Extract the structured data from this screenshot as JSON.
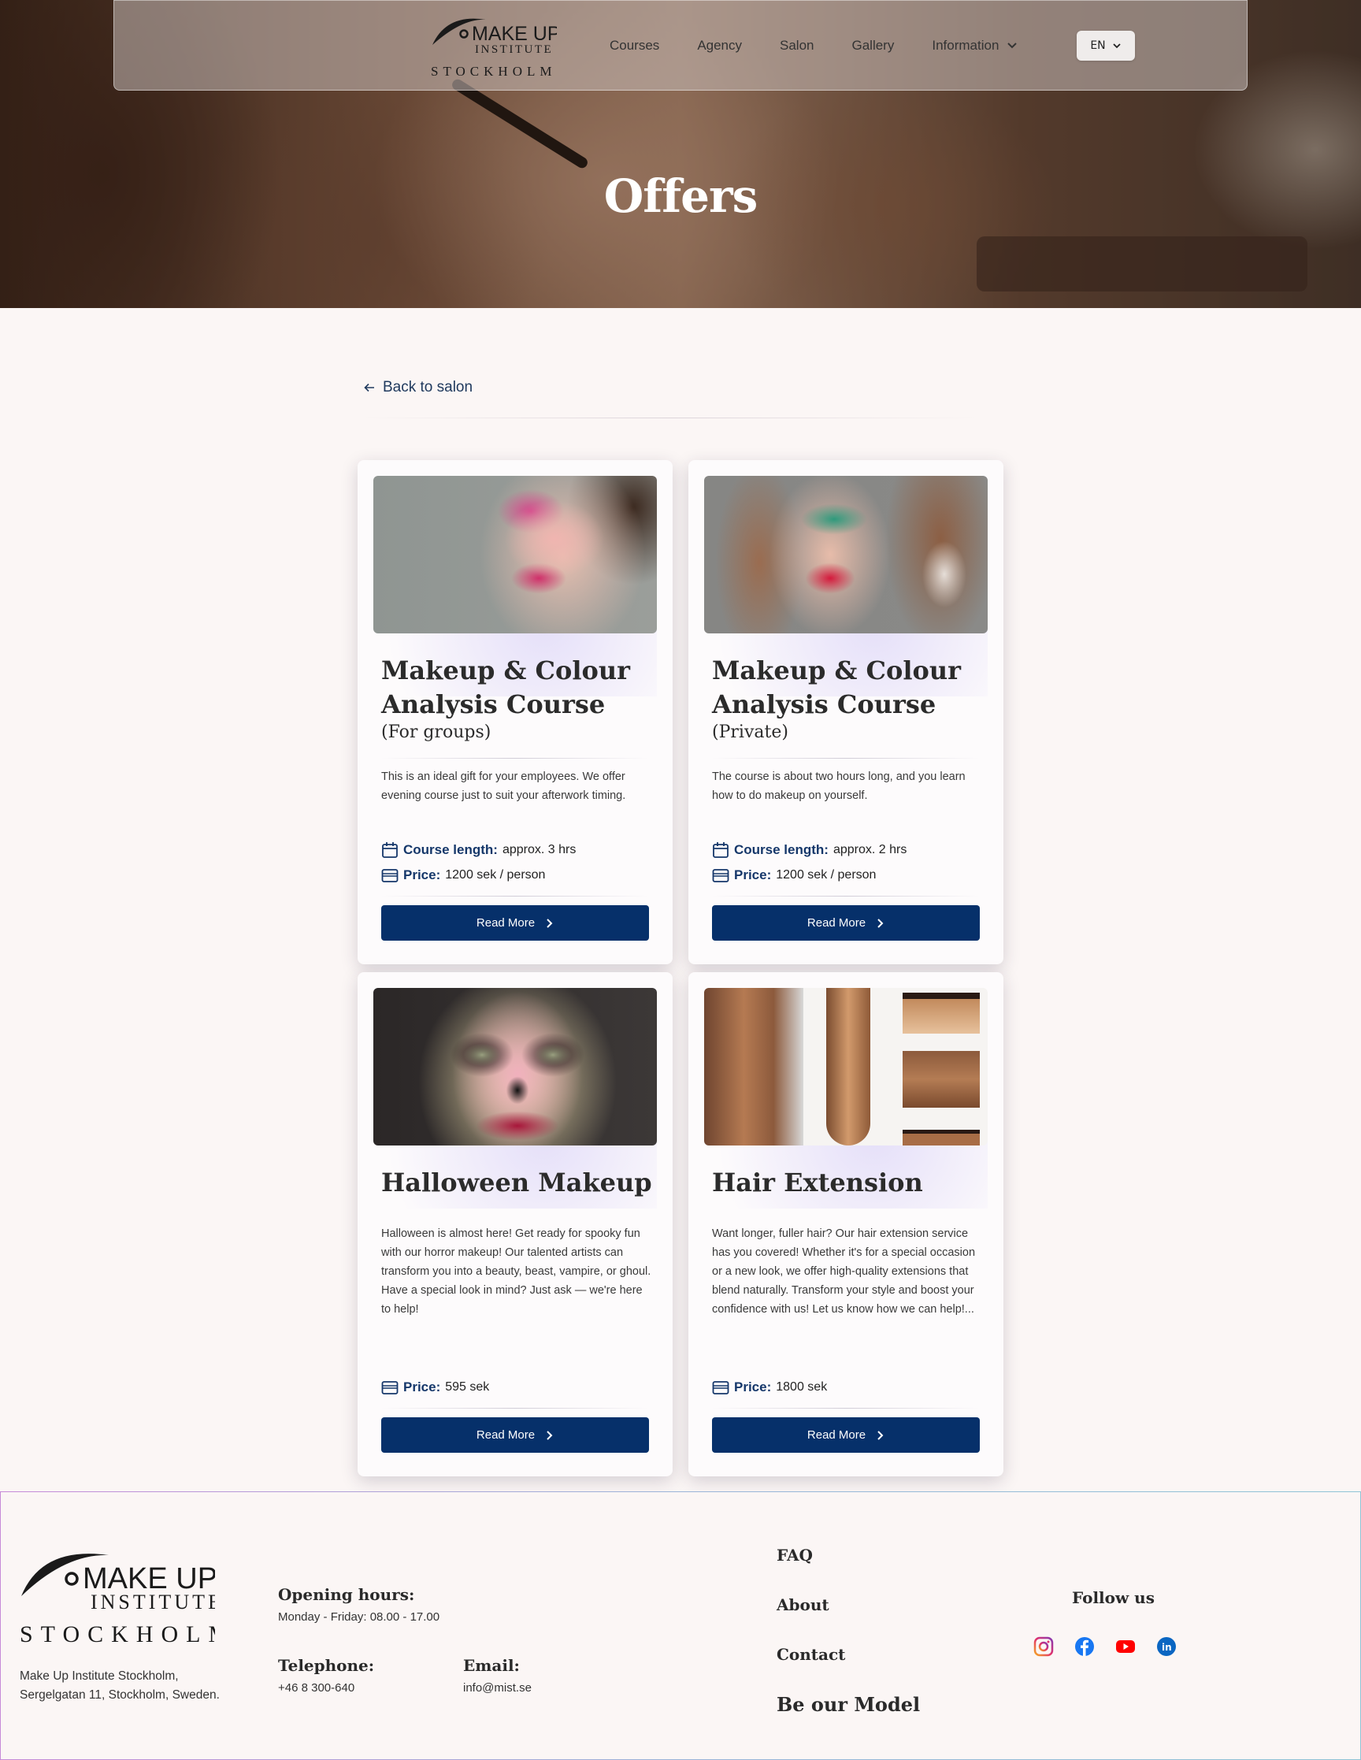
{
  "nav": {
    "logo": {
      "line1": "MAKE UP",
      "line2": "INSTITUTE",
      "line3": "STOCKHOLM"
    },
    "links": [
      "Courses",
      "Agency",
      "Salon",
      "Gallery",
      "Information"
    ],
    "lang": "EN"
  },
  "hero": {
    "title": "Offers"
  },
  "back_link": "Back to salon",
  "cards": [
    {
      "title": "Makeup & Colour Analysis Course",
      "subtitle": "(For groups)",
      "description": "This is an ideal gift for your employees. We offer evening course just to suit your afterwork timing.",
      "length_label": "Course length:",
      "length_value": "approx.  3 hrs",
      "price_label": "Price:",
      "price_value": "1200 sek / person",
      "button": "Read More"
    },
    {
      "title": "Makeup & Colour Analysis Course",
      "subtitle": "(Private)",
      "description": "The course is about two hours long, and you learn how to do makeup on yourself.",
      "length_label": "Course length:",
      "length_value": "approx.  2 hrs",
      "price_label": "Price:",
      "price_value": "1200 sek / person",
      "button": "Read More"
    },
    {
      "title": "Halloween Makeup",
      "description": "Halloween is almost here! Get ready for spooky fun with our horror makeup! Our talented artists can transform you into a beauty, beast, vampire, or ghoul. Have a special look in mind? Just ask — we're here to help!",
      "price_label": "Price:",
      "price_value": "595 sek",
      "button": "Read More"
    },
    {
      "title": "Hair Extension",
      "description": "Want longer, fuller hair? Our hair extension service has you covered! Whether it's for a special occasion or a new look, we offer high-quality extensions that blend naturally. Transform your style and boost your confidence with us! Let us know how we can help!...",
      "price_label": "Price:",
      "price_value": "1800 sek",
      "button": "Read More"
    }
  ],
  "footer": {
    "address_line1": "Make Up Institute Stockholm,",
    "address_line2": "Sergelgatan 11, Stockholm, Sweden.",
    "hours_label": "Opening hours:",
    "hours_value": "Monday - Friday: 08.00  - 17.00",
    "phone_label": "Telephone:",
    "phone_value": "+46 8 300-640",
    "email_label": "Email:",
    "email_value": "info@mist.se",
    "links": [
      "FAQ",
      "About",
      "Contact",
      "Be our Model"
    ],
    "follow_label": "Follow us",
    "socials": [
      "instagram-icon",
      "facebook-icon",
      "youtube-icon",
      "linkedin-icon"
    ]
  },
  "colors": {
    "primary": "#06306a",
    "label": "#15376a",
    "background": "#fbf6f5"
  }
}
